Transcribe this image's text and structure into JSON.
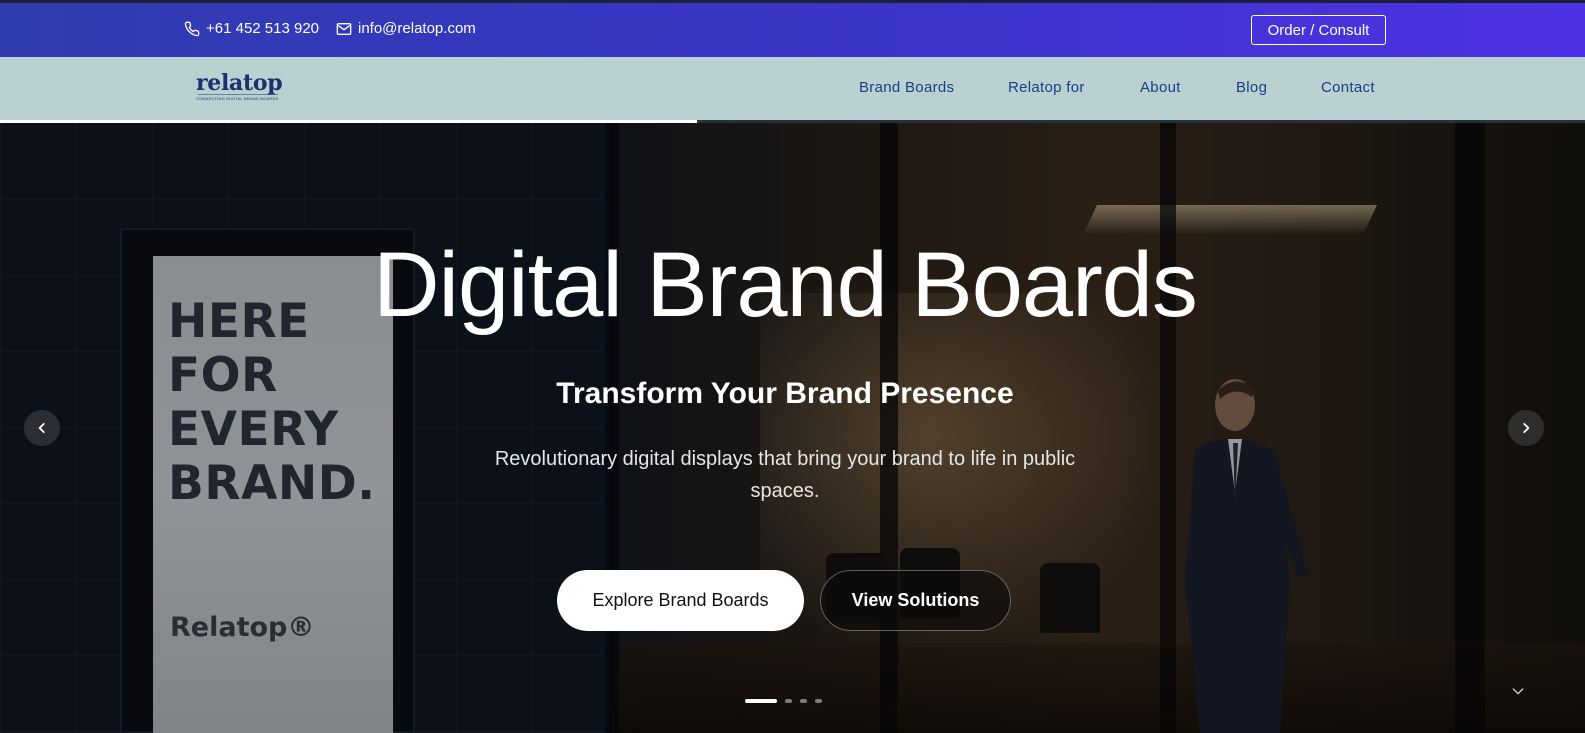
{
  "topbar": {
    "phone": "+61 452 513 920",
    "email": "info@relatop.com",
    "order_label": "Order / Consult",
    "phone_icon": "phone-icon",
    "email_icon": "mail-icon",
    "background_colors": [
      "#2f3cae",
      "#4f32e6"
    ]
  },
  "navbar": {
    "logo_text": "relatop",
    "logo_tagline": "CONNECTING DIGITAL BRAND BOARDS",
    "items": [
      {
        "label": "Brand Boards"
      },
      {
        "label": "Relatop for"
      },
      {
        "label": "About"
      },
      {
        "label": "Blog"
      },
      {
        "label": "Contact"
      }
    ],
    "background": "#b9d1d0",
    "text_color": "#1f3b8a"
  },
  "slider": {
    "progress_fraction": 0.44,
    "slide_count": 4,
    "active_slide": 1
  },
  "hero": {
    "title": "Digital Brand Boards",
    "subtitle": "Transform Your Brand Presence",
    "description": "Revolutionary digital displays that bring your brand to life in public spaces.",
    "primary_button": "Explore Brand Boards",
    "secondary_button": "View Solutions",
    "poster_text": "HERE FOR EVERY BRAND.",
    "poster_brand": "Relatop®",
    "prev_icon": "chevron-left-icon",
    "next_icon": "chevron-right-icon",
    "scroll_icon": "chevron-down-icon"
  }
}
